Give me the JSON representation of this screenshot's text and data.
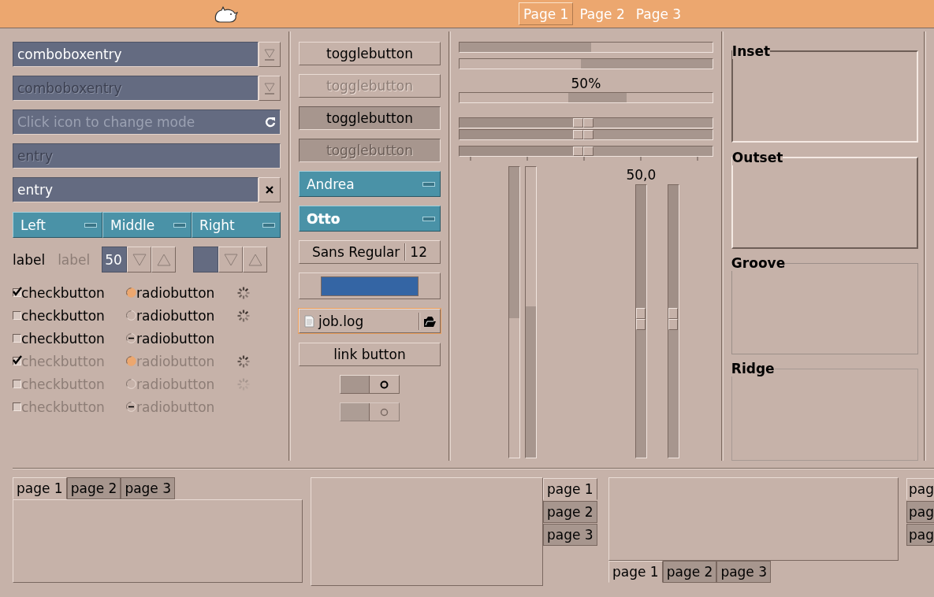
{
  "header_tabs": [
    {
      "label": "Page 1",
      "selected": true
    },
    {
      "label": "Page 2",
      "selected": false
    },
    {
      "label": "Page 3",
      "selected": false
    }
  ],
  "entries": [
    {
      "kind": "combo",
      "value": "comboboxentry",
      "disabled": false
    },
    {
      "kind": "combo",
      "value": "comboboxentry",
      "disabled": true
    },
    {
      "kind": "icon",
      "placeholder": "Click icon to change mode",
      "disabled": false
    },
    {
      "kind": "plain",
      "value": "entry",
      "disabled": true
    },
    {
      "kind": "clear",
      "value": "entry",
      "disabled": false
    }
  ],
  "combo_row": [
    {
      "label": "Left"
    },
    {
      "label": "Middle"
    },
    {
      "label": "Right"
    }
  ],
  "labels": [
    {
      "text": "label",
      "disabled": false
    },
    {
      "text": "label",
      "disabled": true
    }
  ],
  "spin_buttons": [
    {
      "kind": "value",
      "value": "50"
    },
    {
      "kind": "empty"
    }
  ],
  "check_rows": [
    {
      "check": {
        "label": "checkbutton",
        "checked": true
      },
      "radio": {
        "label": "radiobutton",
        "selected": true,
        "inconsistent": false
      },
      "spinner_active": true,
      "disabled": false
    },
    {
      "check": {
        "label": "checkbutton",
        "checked": false
      },
      "radio": {
        "label": "radiobutton",
        "selected": false,
        "inconsistent": false
      },
      "spinner_active": true,
      "disabled": false
    },
    {
      "check": {
        "label": "checkbutton",
        "checked": false
      },
      "radio": {
        "label": "radiobutton",
        "selected": false,
        "inconsistent": true
      },
      "disabled": false
    },
    {
      "check": {
        "label": "checkbutton",
        "checked": true
      },
      "radio": {
        "label": "radiobutton",
        "selected": true,
        "inconsistent": false
      },
      "spinner_active": true,
      "disabled": true
    },
    {
      "check": {
        "label": "checkbutton",
        "checked": false
      },
      "radio": {
        "label": "radiobutton",
        "selected": false,
        "inconsistent": false
      },
      "spinner_active": false,
      "disabled": true
    },
    {
      "check": {
        "label": "checkbutton",
        "checked": false
      },
      "radio": {
        "label": "radiobutton",
        "selected": false,
        "inconsistent": true
      },
      "disabled": true
    }
  ],
  "toggle_buttons": [
    {
      "label": "togglebutton",
      "active": false,
      "disabled": false
    },
    {
      "label": "togglebutton",
      "active": false,
      "disabled": true
    },
    {
      "label": "togglebutton",
      "active": true,
      "disabled": false
    },
    {
      "label": "togglebutton",
      "active": true,
      "disabled": true
    }
  ],
  "combo_boxes": [
    {
      "label": "Andrea",
      "bold": false
    },
    {
      "label": "Otto",
      "bold": true
    }
  ],
  "font_button": {
    "name": "Sans Regular",
    "size": "12"
  },
  "color_button": {
    "color": "#3465a4"
  },
  "file_button": {
    "name": "job.log",
    "focused": true
  },
  "link_button": {
    "label": "link button"
  },
  "switches": [
    {
      "on": false,
      "disabled": false
    },
    {
      "on": false,
      "disabled": true
    }
  ],
  "progress_bars": [
    {
      "level": 0.52,
      "inverted": false
    },
    {
      "level": 0.52,
      "inverted": true
    }
  ],
  "activity_bar": {
    "text": "50%"
  },
  "h_scales": [
    {
      "level": 0.49,
      "marks": false
    },
    {
      "level": 0.49,
      "marks": false
    },
    {
      "level": 0.49,
      "marks": true
    }
  ],
  "v_progress_bars": [
    {
      "level": 0.52,
      "inverted": false
    },
    {
      "level": 0.52,
      "inverted": true
    }
  ],
  "v_scales": [
    {
      "level": 0.49,
      "value_text": "50,0"
    },
    {
      "level": 0.49
    }
  ],
  "frames": [
    {
      "label": "Inset",
      "kind": "inset"
    },
    {
      "label": "Outset",
      "kind": "outset"
    },
    {
      "label": "Groove",
      "kind": "groove"
    },
    {
      "label": "Ridge",
      "kind": "ridge"
    }
  ],
  "notebooks": [
    {
      "kind": "top",
      "tabs": [
        {
          "label": "page 1",
          "selected": true
        },
        {
          "label": "page 2",
          "selected": false
        },
        {
          "label": "page 3",
          "selected": false
        }
      ]
    },
    {
      "kind": "right",
      "tabs": [
        {
          "label": "page 1",
          "selected": true
        },
        {
          "label": "page 2",
          "selected": false
        },
        {
          "label": "page 3",
          "selected": false
        }
      ]
    },
    {
      "kind": "bottom",
      "tabs": [
        {
          "label": "page 1",
          "selected": true
        },
        {
          "label": "page 2",
          "selected": false
        },
        {
          "label": "page 3",
          "selected": false
        }
      ]
    },
    {
      "kind": "left",
      "tabs": [
        {
          "label": "pag",
          "selected": true
        },
        {
          "label": "pag",
          "selected": false
        },
        {
          "label": "pag",
          "selected": false
        }
      ]
    }
  ]
}
